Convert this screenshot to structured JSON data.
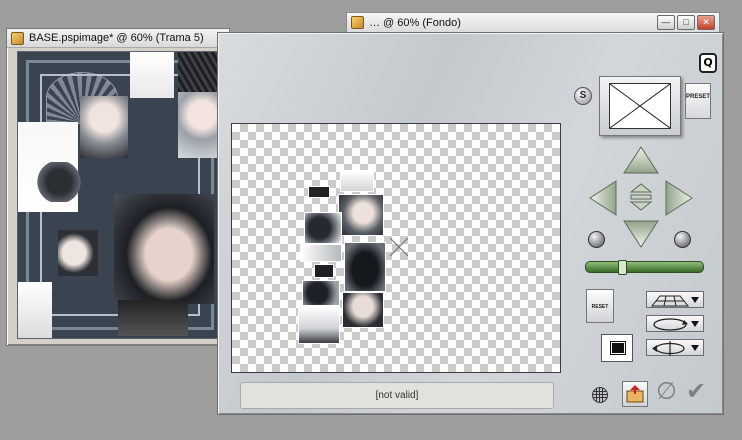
{
  "windows": {
    "base": {
      "title": "BASE.pspimage* @  60% (Trama 5)"
    },
    "fondo": {
      "title": "… @  60% (Fondo)",
      "min_label": "—",
      "max_label": "□",
      "close_label": "✕"
    }
  },
  "plugin": {
    "logo_label": "Q",
    "s_label": "S",
    "preset_label": "PRESET",
    "reset_label": "RESET",
    "status_text": "[not valid]",
    "cancel_label": "∅",
    "ok_label": "✔",
    "slider_value": 0.3,
    "accent_green": "#6aa84f"
  },
  "icons": [
    "document-icon",
    "minimize-icon",
    "maximize-icon",
    "close-icon",
    "arrow-up-icon",
    "arrow-down-icon",
    "arrow-left-icon",
    "arrow-right-icon",
    "center-up-down-icon",
    "rotate-left-icon",
    "rotate-right-icon",
    "perspective-grid-icon",
    "ellipse-icon",
    "flip-icon",
    "grid-icon",
    "load-icon",
    "cancel-icon",
    "ok-icon"
  ]
}
